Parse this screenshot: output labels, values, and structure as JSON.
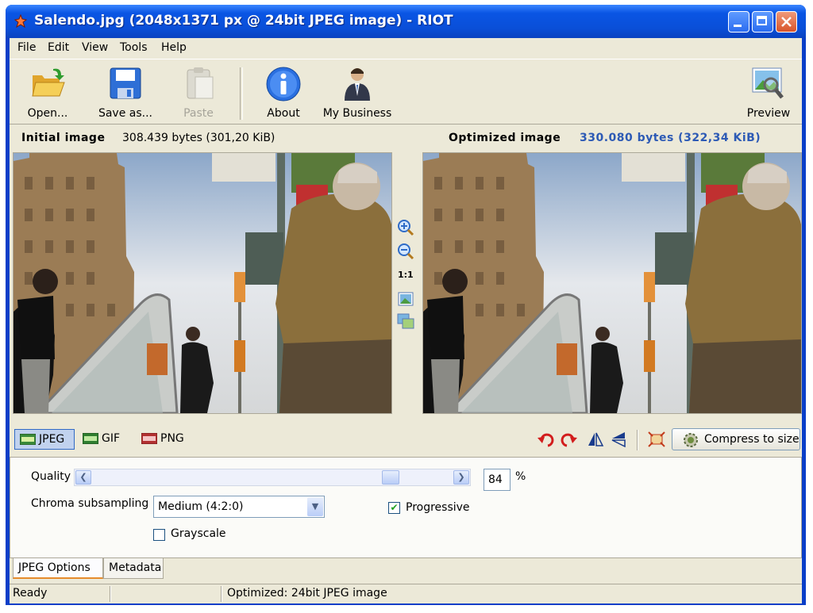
{
  "window": {
    "title": "Salendo.jpg (2048x1371 px @ 24bit JPEG image) - RIOT",
    "controls": [
      "minimize",
      "maximize",
      "close"
    ]
  },
  "menu": {
    "items": [
      "File",
      "Edit",
      "View",
      "Tools",
      "Help"
    ]
  },
  "toolbar": {
    "open_label": "Open...",
    "save_label": "Save as...",
    "paste_label": "Paste",
    "about_label": "About",
    "business_label": "My Business",
    "preview_label": "Preview"
  },
  "images": {
    "initial_label": "Initial image",
    "initial_size": "308.439 bytes (301,20 KiB)",
    "optimized_label": "Optimized image",
    "optimized_size": "330.080 bytes (322,34 KiB)",
    "optimized_size_color": "#2d5ab5"
  },
  "zoom": {
    "zoom_in": "zoom-in-icon",
    "zoom_out": "zoom-out-icon",
    "actual_size": "1:1",
    "fit": "fit-icon",
    "compare": "compare-icon"
  },
  "formats": {
    "jpeg": "JPEG",
    "gif": "GIF",
    "png": "PNG",
    "selected": "JPEG"
  },
  "compress_label": "Compress to size",
  "options": {
    "quality_label": "Quality",
    "quality_value": "84",
    "quality_fraction": 0.84,
    "quality_unit": "%",
    "chroma_label": "Chroma subsampling",
    "chroma_value": "Medium (4:2:0)",
    "progressive_label": "Progressive",
    "progressive_checked": true,
    "grayscale_label": "Grayscale",
    "grayscale_checked": false
  },
  "tabs": [
    "JPEG Options",
    "Metadata"
  ],
  "status": {
    "state": "Ready",
    "message": "Optimized: 24bit JPEG image"
  }
}
